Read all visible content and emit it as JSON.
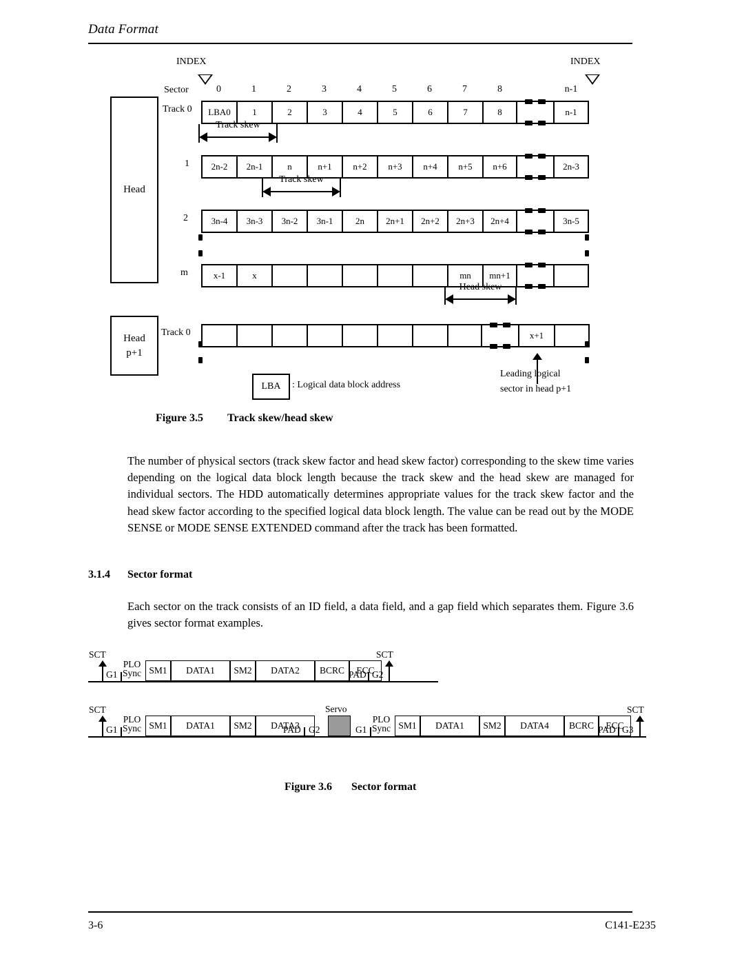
{
  "header": {
    "title": "Data Format"
  },
  "figure35": {
    "caption_num": "Figure 3.5",
    "caption_text": "Track skew/head skew",
    "index_left_label": "INDEX",
    "index_right_label": "INDEX",
    "sector_label": "Sector",
    "sector_numbers": [
      "0",
      "1",
      "2",
      "3",
      "4",
      "5",
      "6",
      "7",
      "8"
    ],
    "sector_last": "n-1",
    "head_label": "Head",
    "head_p1_label_line1": "Head",
    "head_p1_label_line2": "p+1",
    "track0_label": "Track 0",
    "track0b_label": "Track 0",
    "row_labels": {
      "r1": "1",
      "r2": "2",
      "rm": "m"
    },
    "rows": [
      {
        "name": "track-0",
        "cells": [
          "LBA0",
          "1",
          "2",
          "3",
          "4",
          "5",
          "6",
          "7",
          "8"
        ],
        "tail": [
          "n-1"
        ]
      },
      {
        "name": "track-1",
        "cells": [
          "2n-2",
          "2n-1",
          "n",
          "n+1",
          "n+2",
          "n+3",
          "n+4",
          "n+5",
          "n+6"
        ],
        "tail": [
          "2n-3"
        ]
      },
      {
        "name": "track-2",
        "cells": [
          "3n-4",
          "3n-3",
          "3n-2",
          "3n-1",
          "2n",
          "2n+1",
          "2n+2",
          "2n+3",
          "2n+4"
        ],
        "tail": [
          "3n-5"
        ]
      },
      {
        "name": "track-m",
        "cells": [
          "x-1",
          "x",
          "",
          "",
          "",
          "",
          "",
          "mn",
          "mn+1"
        ],
        "tail": [
          ""
        ]
      },
      {
        "name": "track-p1",
        "cells": [
          "",
          "",
          "",
          "",
          "",
          "",
          "",
          ""
        ],
        "tail": [
          "x+1",
          ""
        ]
      }
    ],
    "track_skew_label_1": "Track skew",
    "track_skew_label_2": "Track skew",
    "head_skew_label": "Head skew",
    "legend_box": "LBA",
    "legend_text": ": Logical data block address",
    "leading_note_line1": "Leading logical",
    "leading_note_line2": "sector in head p+1"
  },
  "body": {
    "paragraph1": "The number of physical sectors (track skew factor and head skew factor) corresponding to the skew time varies depending on the logical data block length because the track skew and the head skew are managed for individual sectors.  The HDD automatically determines appropriate values for the track skew factor and the head skew factor according to the specified logical data block length.  The value can be read out by the MODE SENSE or MODE SENSE EXTENDED command after the track has been formatted.",
    "section_number": "3.1.4",
    "section_title": "Sector format",
    "paragraph2": "Each sector on the track consists of an ID field, a data field, and a gap field which separates them.  Figure 3.6 gives sector format examples."
  },
  "figure36": {
    "caption_num": "Figure 3.6",
    "caption_text": "Sector format",
    "sct_label": "SCT",
    "g1_label": "G1",
    "plo_label_line1": "PLO",
    "plo_label_line2": "Sync",
    "pad_label": "PAD",
    "g2_label": "G2",
    "g3_label": "G3",
    "servo_label": "Servo",
    "row1_boxes": [
      "SM1",
      "DATA1",
      "SM2",
      "DATA2",
      "BCRC",
      "ECC"
    ],
    "row2_left_boxes": [
      "SM1",
      "DATA1",
      "SM2",
      "DATA3"
    ],
    "row2_right_boxes": [
      "SM1",
      "DATA1",
      "SM2",
      "DATA4",
      "BCRC",
      "ECC"
    ]
  },
  "footer": {
    "page": "3-6",
    "doc_id": "C141-E235"
  }
}
